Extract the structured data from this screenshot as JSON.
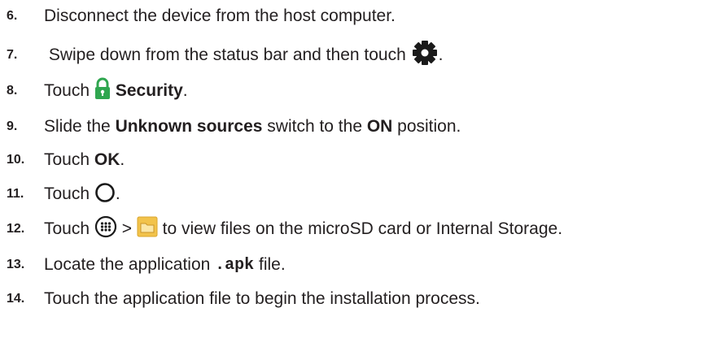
{
  "steps": [
    {
      "number": "6.",
      "parts": {
        "a": "Disconnect the device from the host computer."
      }
    },
    {
      "number": "7.",
      "parts": {
        "a": " Swipe down from the status bar and then touch ",
        "icon": "gear-icon",
        "b": "."
      }
    },
    {
      "number": "8.",
      "parts": {
        "a": "Touch ",
        "icon": "lock-icon",
        "bold": "Security",
        "b": "."
      }
    },
    {
      "number": "9.",
      "parts": {
        "a": "Slide the ",
        "bold1": "Unknown sources",
        "b": " switch to the ",
        "bold2": "ON",
        "c": " position."
      }
    },
    {
      "number": "10.",
      "parts": {
        "a": "Touch ",
        "bold": "OK",
        "b": "."
      }
    },
    {
      "number": "11.",
      "parts": {
        "a": "Touch ",
        "icon": "home-circle-icon",
        "b": "."
      }
    },
    {
      "number": "12.",
      "parts": {
        "a": "Touch ",
        "icon1": "apps-icon",
        "sep": " > ",
        "icon2": "file-browser-icon",
        "b": " to view files on the microSD card or Internal Storage."
      }
    },
    {
      "number": "13.",
      "parts": {
        "a": "Locate the application ",
        "code": ".apk",
        "b": " file."
      }
    },
    {
      "number": "14.",
      "parts": {
        "a": "Touch the application file to begin the installation process."
      }
    }
  ],
  "colors": {
    "text": "#231f20",
    "lock": "#2fa64f",
    "folder": "#f2c34b"
  }
}
